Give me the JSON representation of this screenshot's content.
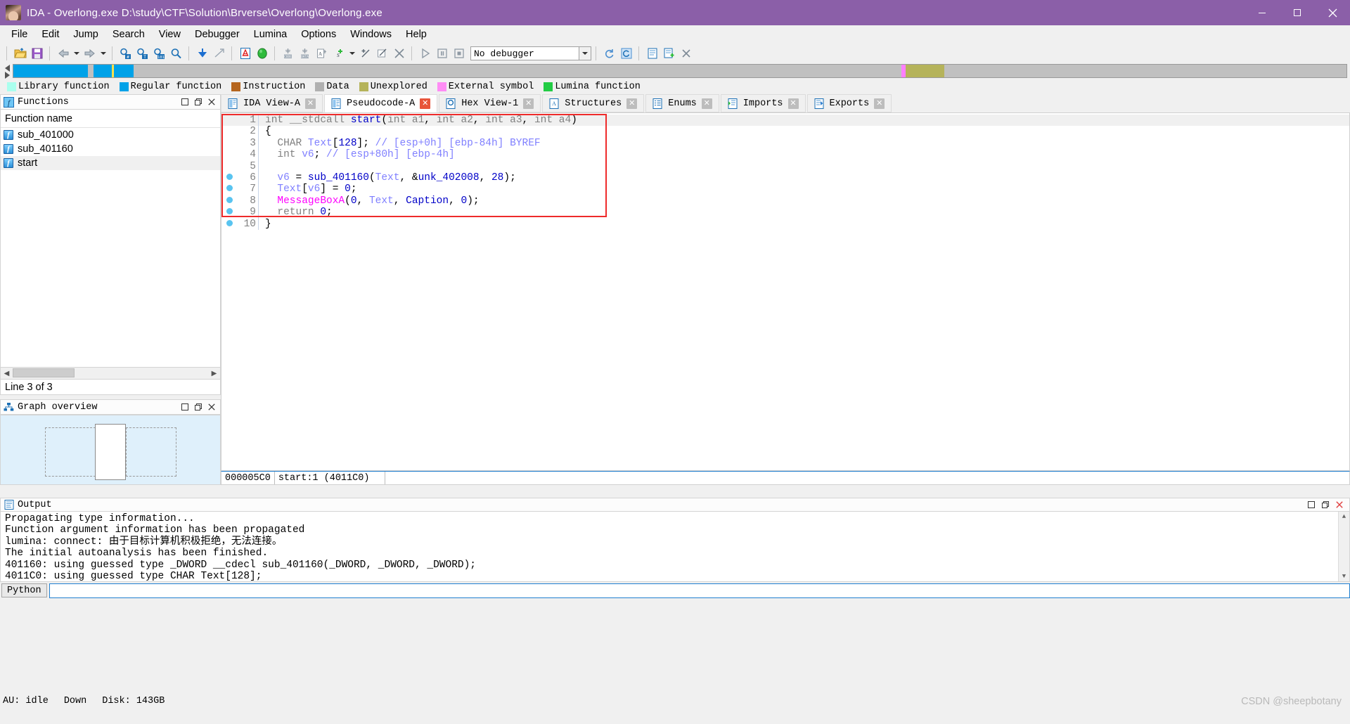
{
  "window": {
    "title": "IDA - Overlong.exe D:\\study\\CTF\\Solution\\Brverse\\Overlong\\Overlong.exe",
    "icon": "ida-app-icon",
    "minimize": "minimize-icon",
    "maximize": "maximize-icon",
    "close": "close-icon",
    "titlebar_color": "#8b5fa8"
  },
  "menubar": {
    "items": [
      {
        "label": "File"
      },
      {
        "label": "Edit"
      },
      {
        "label": "Jump"
      },
      {
        "label": "Search"
      },
      {
        "label": "View"
      },
      {
        "label": "Debugger"
      },
      {
        "label": "Lumina"
      },
      {
        "label": "Options"
      },
      {
        "label": "Windows"
      },
      {
        "label": "Help"
      }
    ]
  },
  "toolbar": {
    "debugger_select": "No debugger",
    "buttons": [
      "open-file-icon",
      "save-icon",
      "back-arrow-icon",
      "forward-arrow-icon",
      "search-hash-icon",
      "search-text-icon",
      "search-binary-icon",
      "search-sequence-icon",
      "jump-down-icon",
      "jump-crossref-icon",
      "graph-view-icon",
      "run-analysis-icon",
      "make-code-icon",
      "make-data-icon",
      "make-string-icon",
      "make-struct-icon",
      "create-function-icon",
      "edit-function-icon",
      "undefine-icon",
      "run-icon",
      "pause-icon",
      "stop-icon"
    ]
  },
  "navband": {
    "segments": [
      {
        "color": "#00a2e8",
        "left_pct": 0.0,
        "width_pct": 5.6
      },
      {
        "color": "#00a2e8",
        "left_pct": 6.0,
        "width_pct": 3.0
      },
      {
        "color": "#c0c0c0",
        "left_pct": 9.0,
        "width_pct": 57.6
      },
      {
        "color": "#ff7fff",
        "left_pct": 66.6,
        "width_pct": 0.35
      },
      {
        "color": "#b5b35a",
        "left_pct": 66.95,
        "width_pct": 2.9
      },
      {
        "color": "#c0c0c0",
        "left_pct": 69.85,
        "width_pct": 30.15
      }
    ],
    "cursor_pct": 7.4
  },
  "legend": {
    "items": [
      {
        "label": "Library function",
        "color": "#aaffee"
      },
      {
        "label": "Regular function",
        "color": "#00a2e8"
      },
      {
        "label": "Instruction",
        "color": "#b5651d"
      },
      {
        "label": "Data",
        "color": "#b0b0b0"
      },
      {
        "label": "Unexplored",
        "color": "#b5b35a"
      },
      {
        "label": "External symbol",
        "color": "#ff8cf5"
      },
      {
        "label": "Lumina function",
        "color": "#22cc44"
      }
    ]
  },
  "functions_panel": {
    "title": "Functions",
    "icon": "functions-panel-icon",
    "column_header": "Function name",
    "rows": [
      {
        "name": "sub_401000",
        "selected": false
      },
      {
        "name": "sub_401160",
        "selected": false
      },
      {
        "name": "start",
        "selected": true
      }
    ],
    "status": "Line 3 of 3",
    "buttons": [
      "restore-icon",
      "float-icon",
      "close-icon"
    ]
  },
  "graph_overview": {
    "title": "Graph overview",
    "icon": "graph-overview-icon",
    "buttons": [
      "restore-icon",
      "float-icon",
      "close-icon"
    ]
  },
  "tabs": [
    {
      "label": "IDA View-A",
      "icon": "ida-view-icon",
      "active": false,
      "close": "close-icon"
    },
    {
      "label": "Pseudocode-A",
      "icon": "pseudocode-icon",
      "active": true,
      "close": "close-icon"
    },
    {
      "label": "Hex View-1",
      "icon": "hex-view-icon",
      "active": false,
      "close": "close-icon"
    },
    {
      "label": "Structures",
      "icon": "structures-icon",
      "active": false,
      "close": "close-icon"
    },
    {
      "label": "Enums",
      "icon": "enums-icon",
      "active": false,
      "close": "close-icon"
    },
    {
      "label": "Imports",
      "icon": "imports-icon",
      "active": false,
      "close": "close-icon"
    },
    {
      "label": "Exports",
      "icon": "exports-icon",
      "active": false,
      "close": "close-icon"
    }
  ],
  "pseudocode": {
    "lines": [
      {
        "num": "1",
        "bp": false,
        "text": "int __stdcall start(int a1, int a2, int a3, int a4)"
      },
      {
        "num": "2",
        "bp": false,
        "text": "{"
      },
      {
        "num": "3",
        "bp": false,
        "text": "  CHAR Text[128]; // [esp+0h] [ebp-84h] BYREF"
      },
      {
        "num": "4",
        "bp": false,
        "text": "  int v6; // [esp+80h] [ebp-4h]"
      },
      {
        "num": "5",
        "bp": false,
        "text": ""
      },
      {
        "num": "6",
        "bp": true,
        "text": "  v6 = sub_401160(Text, &unk_402008, 28);"
      },
      {
        "num": "7",
        "bp": true,
        "text": "  Text[v6] = 0;"
      },
      {
        "num": "8",
        "bp": true,
        "text": "  MessageBoxA(0, Text, Caption, 0);"
      },
      {
        "num": "9",
        "bp": true,
        "text": "  return 0;"
      },
      {
        "num": "10",
        "bp": true,
        "text": "}"
      }
    ],
    "status": {
      "offset": "000005C0",
      "location": "start:1 (4011C0)"
    },
    "highlight_color": "#ee2b2b"
  },
  "output_window": {
    "title": "Output",
    "icon": "output-icon",
    "buttons": [
      "restore-icon",
      "float-icon",
      "close-icon"
    ],
    "lines": [
      "Propagating type information...",
      "Function argument information has been propagated",
      "lumina: connect: 由于目标计算机积极拒绝，无法连接。",
      "The initial autoanalysis has been finished.",
      "401160: using guessed type _DWORD __cdecl sub_401160(_DWORD, _DWORD, _DWORD);",
      "4011C0: using guessed type CHAR Text[128];"
    ]
  },
  "python_bar": {
    "button_label": "Python",
    "input_value": "",
    "placeholder": ""
  },
  "statusbar": {
    "au": "AU: idle",
    "down": "Down",
    "disk": "Disk: 143GB",
    "watermark": "CSDN @sheepbotany"
  }
}
